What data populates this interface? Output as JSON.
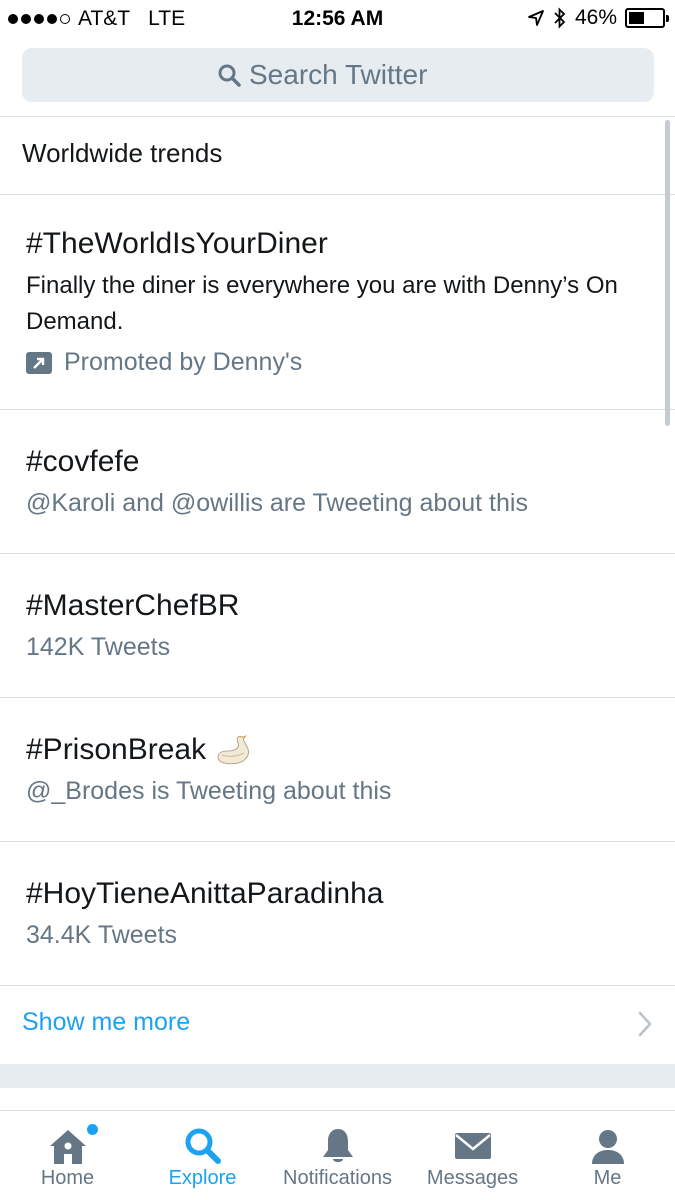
{
  "status_bar": {
    "carrier": "AT&T",
    "network": "LTE",
    "time": "12:56 AM",
    "battery": "46%",
    "battery_level": 0.46
  },
  "search": {
    "placeholder": "Search Twitter"
  },
  "section_title": "Worldwide trends",
  "trends": [
    {
      "name": "#TheWorldIsYourDiner",
      "description": "Finally the diner is everywhere you are with Denny’s On Demand.",
      "meta": "Promoted by Denny's",
      "promoted": true
    },
    {
      "name": "#covfefe",
      "meta": "@Karoli and @owillis are Tweeting about this"
    },
    {
      "name": "#MasterChefBR",
      "meta": "142K Tweets"
    },
    {
      "name": "#PrisonBreak",
      "meta": "@_Brodes is Tweeting about this",
      "icon": "swan-icon"
    },
    {
      "name": "#HoyTieneAnittaParadinha",
      "meta": "34.4K Tweets"
    }
  ],
  "show_more": "Show me more",
  "tabs": [
    {
      "label": "Home",
      "icon": "home-icon"
    },
    {
      "label": "Explore",
      "icon": "search-icon",
      "active": true
    },
    {
      "label": "Notifications",
      "icon": "bell-icon"
    },
    {
      "label": "Messages",
      "icon": "envelope-icon"
    },
    {
      "label": "Me",
      "icon": "person-icon"
    }
  ],
  "colors": {
    "accent": "#1da1f2",
    "secondary_text": "#657786",
    "search_bg": "#e6ecf0"
  }
}
